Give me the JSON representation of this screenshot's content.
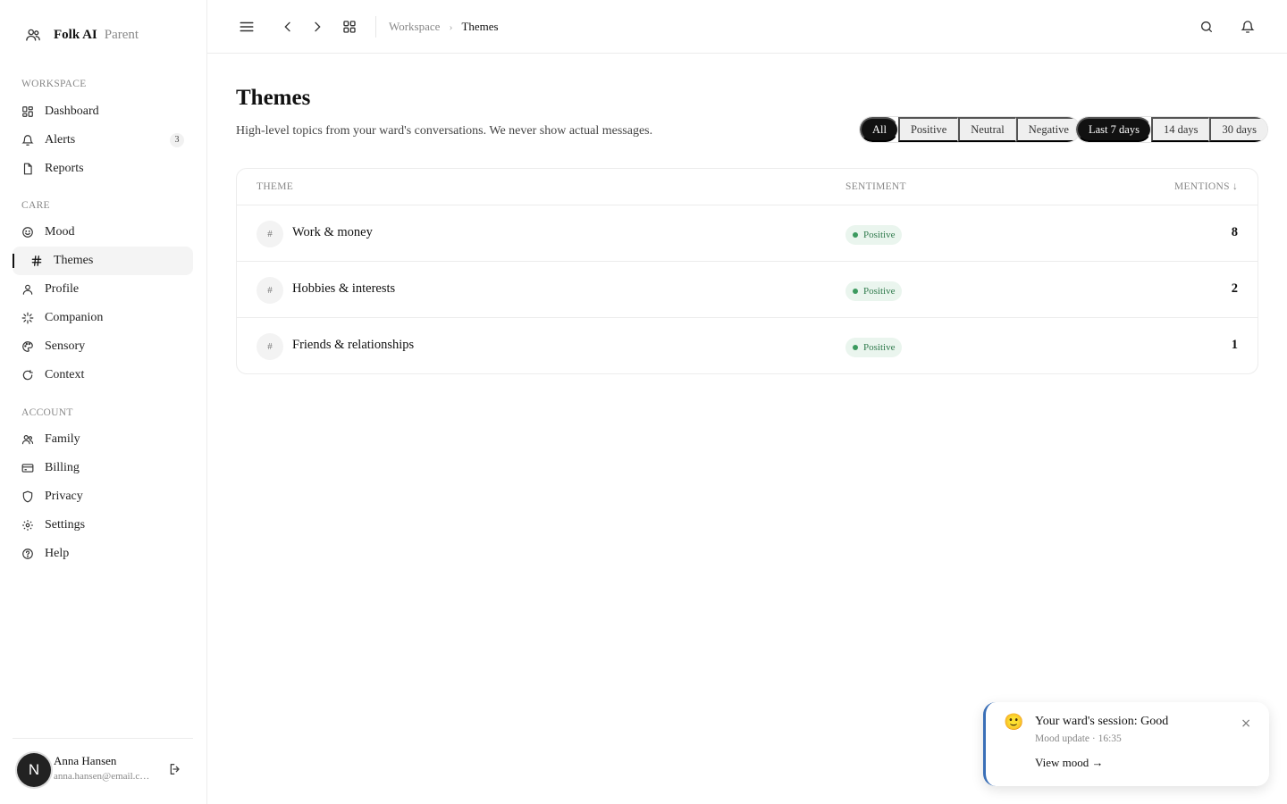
{
  "brand": {
    "name": "Folk AI",
    "role": "Parent",
    "icon": "users-icon"
  },
  "sidebar": {
    "sections": {
      "workspace": "WORKSPACE",
      "care": "CARE",
      "account": "ACCOUNT"
    },
    "items": [
      {
        "label": "Dashboard",
        "icon": "dashboard-icon"
      },
      {
        "label": "Alerts",
        "icon": "bell-icon",
        "badge": "3"
      },
      {
        "label": "Reports",
        "icon": "document-icon"
      },
      {
        "label": "Mood",
        "icon": "smile-icon"
      },
      {
        "label": "Themes",
        "icon": "hash-icon",
        "active": true
      },
      {
        "label": "Profile",
        "icon": "user-icon"
      },
      {
        "label": "Companion",
        "icon": "sparkle-icon"
      },
      {
        "label": "Sensory",
        "icon": "palette-icon"
      },
      {
        "label": "Context",
        "icon": "refresh-icon"
      },
      {
        "label": "Family",
        "icon": "users-icon"
      },
      {
        "label": "Billing",
        "icon": "card-icon"
      },
      {
        "label": "Privacy",
        "icon": "shield-icon"
      },
      {
        "label": "Settings",
        "icon": "gear-icon"
      },
      {
        "label": "Help",
        "icon": "help-icon"
      }
    ],
    "user": {
      "initial": "N",
      "name": "Anna Hansen",
      "email": "anna.hansen@email.com"
    }
  },
  "topbar": {
    "breadcrumb": {
      "parent": "Workspace",
      "current": "Themes"
    }
  },
  "page": {
    "title": "Themes",
    "subtitle": "High-level topics from your ward's conversations. We never show actual messages."
  },
  "filters": {
    "sentiment": [
      "All",
      "Positive",
      "Neutral",
      "Negative"
    ],
    "sentiment_selected": "All",
    "range": [
      "Last 7 days",
      "14 days",
      "30 days"
    ],
    "range_selected": "Last 7 days"
  },
  "table": {
    "headers": {
      "theme": "THEME",
      "sentiment": "SENTIMENT",
      "mentions": "MENTIONS ↓"
    },
    "rows": [
      {
        "theme": "Work & money",
        "sentiment": "Positive",
        "mentions": "8"
      },
      {
        "theme": "Hobbies & interests",
        "sentiment": "Positive",
        "mentions": "2"
      },
      {
        "theme": "Friends & relationships",
        "sentiment": "Positive",
        "mentions": "1"
      }
    ],
    "hash_symbol": "#"
  },
  "toast": {
    "emoji": "🙂",
    "title": "Your ward's session: Good",
    "meta": "Mood update · 16:35",
    "link": "View mood →",
    "close": "×"
  },
  "colors": {
    "accent": "#111111",
    "positive_bg": "#eaf5ee",
    "positive_text": "#2f7a4c",
    "toast_border": "#3a6fb7"
  }
}
